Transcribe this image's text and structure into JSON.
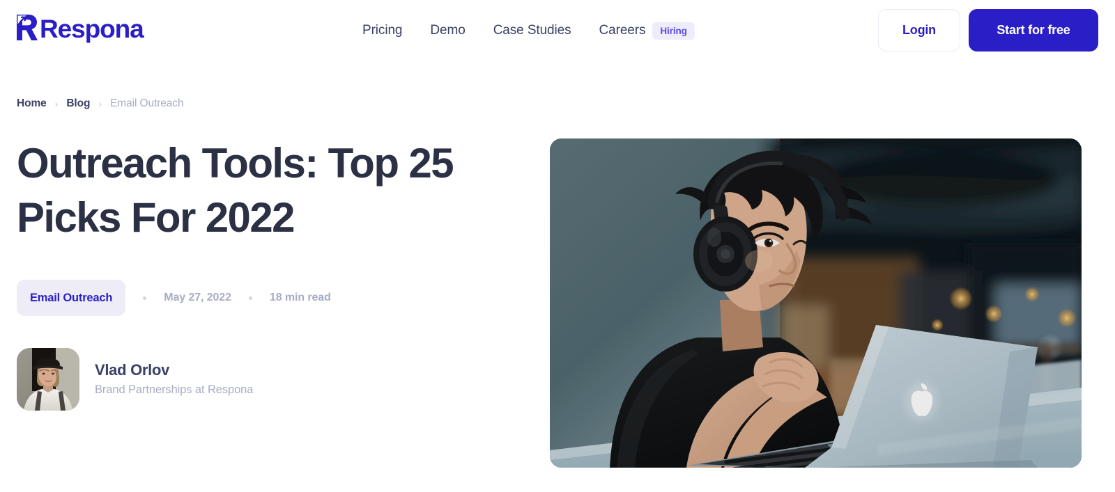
{
  "brand": {
    "name": "Respona",
    "logo_icon": "respona-arrow-r-logo",
    "color": "#2A1FC7"
  },
  "header": {
    "nav": [
      {
        "label": "Pricing",
        "name": "pricing"
      },
      {
        "label": "Demo",
        "name": "demo"
      },
      {
        "label": "Case Studies",
        "name": "case-studies"
      },
      {
        "label": "Careers",
        "name": "careers",
        "badge": "Hiring"
      }
    ],
    "login_label": "Login",
    "cta_label": "Start for free",
    "badge_bg": "#EDECFA",
    "badge_color": "#5B4CE0"
  },
  "breadcrumb": {
    "items": [
      {
        "label": "Home"
      },
      {
        "label": "Blog"
      },
      {
        "label": "Email Outreach"
      }
    ],
    "separator": "›"
  },
  "article": {
    "title": "Outreach Tools: Top 25 Picks For 2022",
    "category": "Email Outreach",
    "date": "May 27, 2022",
    "read_time": "18 min read",
    "category_bg": "#EDECF7",
    "category_color": "#2A1FC7"
  },
  "author": {
    "name": "Vlad Orlov",
    "role": "Brand Partnerships at Respona",
    "avatar_alt": "portrait-of-vlad-orlov-wearing-a-cap-and-white-shirt"
  },
  "hero_image": {
    "alt": "man-wearing-headphones-working-on-a-macbook-in-a-cafe"
  }
}
